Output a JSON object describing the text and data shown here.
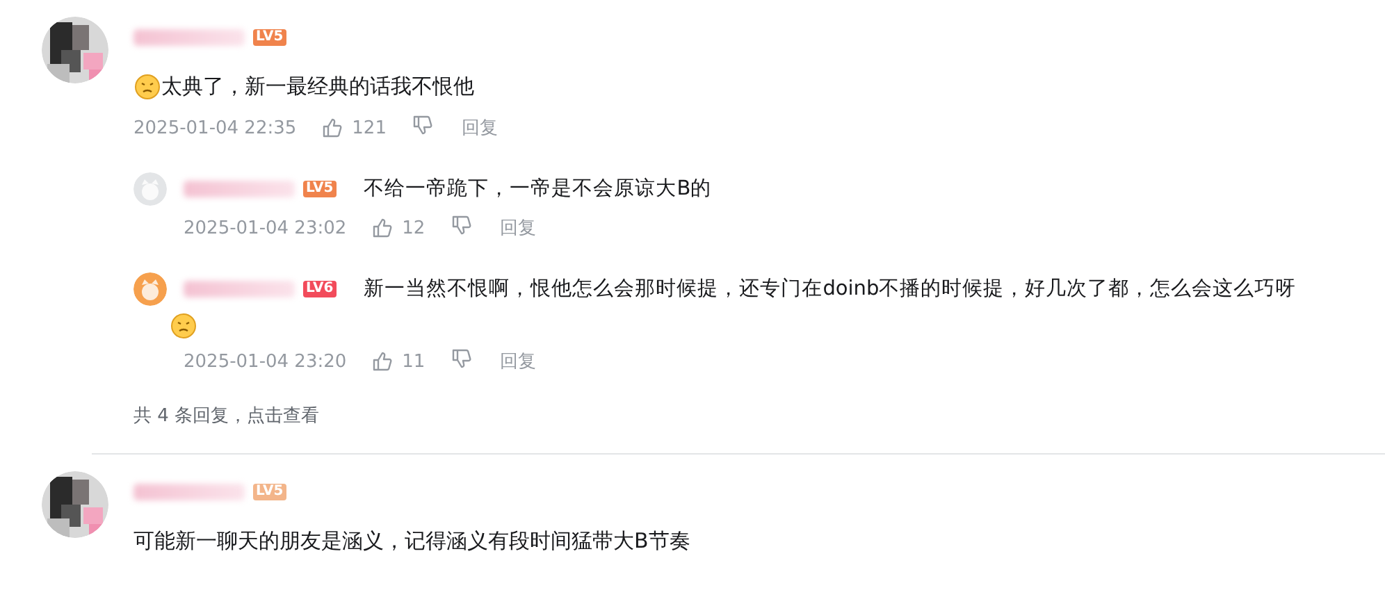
{
  "comments": [
    {
      "level_badge": "LV5",
      "color": "#f0834c",
      "leading_emoji": true,
      "content": "太典了，新一最经典的话我不恨他",
      "time": "2025-01-04 22:35",
      "likes": "121",
      "reply_label": "回复",
      "replies": [
        {
          "avatar": {
            "color": "#e3e5e7"
          },
          "level_badge": "LV5",
          "color": "#f0834c",
          "content": "不给一帝跪下，一帝是不会原谅大B的",
          "trailing_emoji": false,
          "time": "2025-01-04 23:02",
          "likes": "12",
          "reply_label": "回复"
        },
        {
          "avatar": {
            "color": "#f6a04d"
          },
          "level_badge": "LV6",
          "color": "#f24b5b",
          "content": "新一当然不恨啊，恨他怎么会那时候提，还专门在doinb不播的时候提，好几次了都，怎么会这么巧呀",
          "trailing_emoji": true,
          "time": "2025-01-04 23:20",
          "likes": "11",
          "reply_label": "回复"
        }
      ],
      "more_replies": "共 4 条回复，点击查看"
    },
    {
      "level_badge": "LV5",
      "color": "#f3b58a",
      "leading_emoji": false,
      "content": "可能新一聊天的朋友是涵义，记得涵义有段时间猛带大B节奏"
    }
  ]
}
